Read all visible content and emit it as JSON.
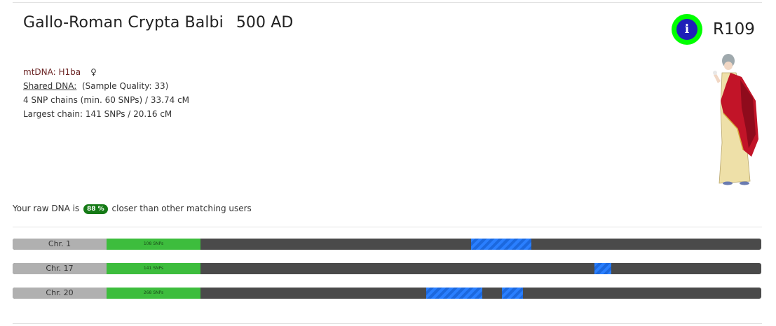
{
  "header": {
    "title": "Gallo-Roman Crypta Balbi",
    "date": "500 AD",
    "code": "R109",
    "info_icon": "info-icon",
    "info_glyph": "i"
  },
  "details": {
    "mtdna": "mtDNA: H1ba",
    "sex_symbol": "♀",
    "shared_dna_label": "Shared DNA:",
    "sample_quality": "(Sample Quality: 33)",
    "snp_chains": "4 SNP chains (min. 60 SNPs) / 33.74 cM",
    "largest_chain": "Largest chain: 141 SNPs / 20.16 cM"
  },
  "closer": {
    "prefix": "Your raw DNA is",
    "percent": "88 %",
    "suffix": "closer than other matching users"
  },
  "colors": {
    "info_ring": "#00ff00",
    "info_inner": "#1f1fb8",
    "snp_green": "#3dbd3d",
    "segment_blue": "#2a7fff",
    "bar_dark": "#4a4a4a",
    "label_gray": "#b0b0b0",
    "badge_green": "#157a16"
  },
  "chromosomes": [
    {
      "label": "Chr. 1",
      "snps": "108 SNPs",
      "segments": [
        {
          "start": 0.6122,
          "end": 0.6926
        }
      ]
    },
    {
      "label": "Chr. 17",
      "snps": "141 SNPs",
      "segments": [
        {
          "start": 0.7772,
          "end": 0.7997
        }
      ]
    },
    {
      "label": "Chr. 20",
      "snps": "268 SNPs",
      "segments": [
        {
          "start": 0.5524,
          "end": 0.6272
        },
        {
          "start": 0.6533,
          "end": 0.6813
        }
      ]
    }
  ]
}
